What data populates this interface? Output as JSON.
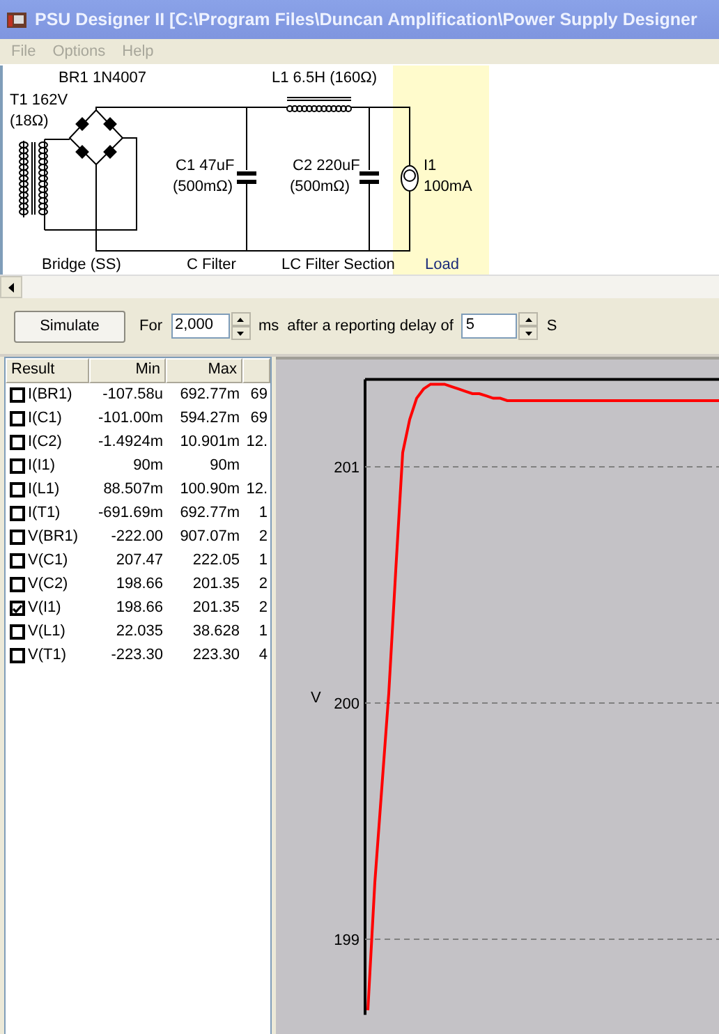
{
  "window": {
    "title": "PSU Designer II  [C:\\Program Files\\Duncan Amplification\\Power Supply Designer"
  },
  "menu": [
    {
      "label": "File",
      "disabled": true
    },
    {
      "label": "Options",
      "disabled": true
    },
    {
      "label": "Help",
      "disabled": true
    }
  ],
  "schematic": {
    "components": [
      {
        "kind": "transformer",
        "labels": [
          "T1 162V",
          "(18Ω)"
        ]
      },
      {
        "kind": "bridge",
        "labels": [
          "BR1 1N4007"
        ]
      },
      {
        "kind": "capacitor",
        "labels": [
          "C1 47uF",
          "(500mΩ)"
        ]
      },
      {
        "kind": "inductor",
        "labels": [
          "L1 6.5H (160Ω)"
        ]
      },
      {
        "kind": "capacitor",
        "labels": [
          "C2 220uF",
          "(500mΩ)"
        ]
      },
      {
        "kind": "current_source",
        "labels": [
          "I1",
          "100mA"
        ]
      }
    ],
    "sections": [
      {
        "label": "Bridge (SS)",
        "selected": false
      },
      {
        "label": "C Filter",
        "selected": false
      },
      {
        "label": "LC Filter Section",
        "selected": false
      },
      {
        "label": "Load",
        "selected": true
      }
    ]
  },
  "toolbar": {
    "simulate_button": "Simulate",
    "for_label": "For",
    "duration": "2,000",
    "duration_unit": "ms",
    "delay_label": "after a reporting delay of",
    "delay": "5",
    "delay_unit": "S"
  },
  "results": {
    "columns": [
      "Result",
      "Min",
      "Max"
    ],
    "rows": [
      {
        "name": "I(BR1)",
        "checked": false,
        "min": "-107.58u",
        "max": "692.77m",
        "column_4": "69"
      },
      {
        "name": "I(C1)",
        "checked": false,
        "min": "-101.00m",
        "max": "594.27m",
        "column_4": "69"
      },
      {
        "name": "I(C2)",
        "checked": false,
        "min": "-1.4924m",
        "max": "10.901m",
        "column_4": "12."
      },
      {
        "name": "I(I1)",
        "checked": false,
        "min": "90m",
        "max": "90m"
      },
      {
        "name": "I(L1)",
        "checked": false,
        "min": "88.507m",
        "max": "100.90m",
        "column_4": "12."
      },
      {
        "name": "I(T1)",
        "checked": false,
        "min": "-691.69m",
        "max": "692.77m",
        "column_4": "1"
      },
      {
        "name": "V(BR1)",
        "checked": false,
        "min": "-222.00",
        "max": "907.07m",
        "column_4": "2"
      },
      {
        "name": "V(C1)",
        "checked": false,
        "min": "207.47",
        "max": "222.05",
        "column_4": "1"
      },
      {
        "name": "V(C2)",
        "checked": false,
        "min": "198.66",
        "max": "201.35",
        "column_4": "2"
      },
      {
        "name": "V(I1)",
        "checked": true,
        "min": "198.66",
        "max": "201.35",
        "column_4": "2"
      },
      {
        "name": "V(L1)",
        "checked": false,
        "min": "22.035",
        "max": "38.628",
        "column_4": "1"
      },
      {
        "name": "V(T1)",
        "checked": false,
        "min": "-223.30",
        "max": "223.30",
        "column_4": "4"
      }
    ]
  },
  "plot": {
    "chart_data": {
      "type": "line",
      "ylabel": "V",
      "yticks": [
        199,
        200,
        201
      ],
      "ylim": [
        198.68,
        201.37
      ],
      "grid": true,
      "series": [
        {
          "color": "#ff0000",
          "values": [
            198.7,
            199.24,
            199.64,
            200.04,
            200.56,
            201.06,
            201.2,
            201.29,
            201.33,
            201.35,
            201.35,
            201.35,
            201.34,
            201.33,
            201.32,
            201.31,
            201.31,
            201.3,
            201.29,
            201.29,
            201.28,
            201.28,
            201.28,
            201.28,
            201.28,
            201.28,
            201.28,
            201.28,
            201.28,
            201.28,
            201.28,
            201.28,
            201.28,
            201.28,
            201.28,
            201.28,
            201.28,
            201.28,
            201.28,
            201.28,
            201.28,
            201.28,
            201.28,
            201.28,
            201.28,
            201.28,
            201.28,
            201.28,
            201.28,
            201.28,
            201.28,
            201.28
          ]
        }
      ]
    }
  }
}
